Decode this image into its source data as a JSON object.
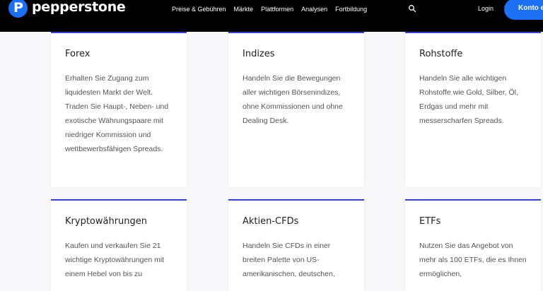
{
  "header": {
    "logo_text": "pepperstone",
    "logo_mark": "P",
    "nav": [
      "Preise & Gebühren",
      "Märkte",
      "Plattformen",
      "Analysen",
      "Fortbildung"
    ],
    "search_icon": "search-icon",
    "login": "Login",
    "cta": "Konto e"
  },
  "cards": [
    {
      "title": "Forex",
      "text": "Erhalten Sie Zugang zum liquidesten Markt der Welt. Traden Sie Haupt-, Neben- und exotische Währungspaare mit niedriger Kommission und wettbewerbsfähigen Spreads."
    },
    {
      "title": "Indizes",
      "text": "Handeln Sie die Bewegungen aller wichtigen Börsenindizes, ohne Kommissionen und ohne Dealing Desk."
    },
    {
      "title": "Rohstoffe",
      "text": "Handeln Sie alle wichtigen Rohstoffe wie Gold, Silber, Öl, Erdgas und mehr mit messerscharfen Spreads."
    },
    {
      "title": "Kryptowährungen",
      "text": "Kaufen und verkaufen Sie 21 wichtige Kryptowährungen mit einem Hebel von bis zu"
    },
    {
      "title": "Aktien-CFDs",
      "text": "Handeln Sie CFDs in einer breiten Palette von US-amerikanischen, deutschen,"
    },
    {
      "title": "ETFs",
      "text": "Nutzen Sie das Angebot von mehr als 100 ETFs, die es Ihnen ermöglichen,"
    }
  ],
  "colors": {
    "brand_blue": "#1d6ff3",
    "card_accent": "#3a44c9",
    "header_bg": "#000000"
  }
}
